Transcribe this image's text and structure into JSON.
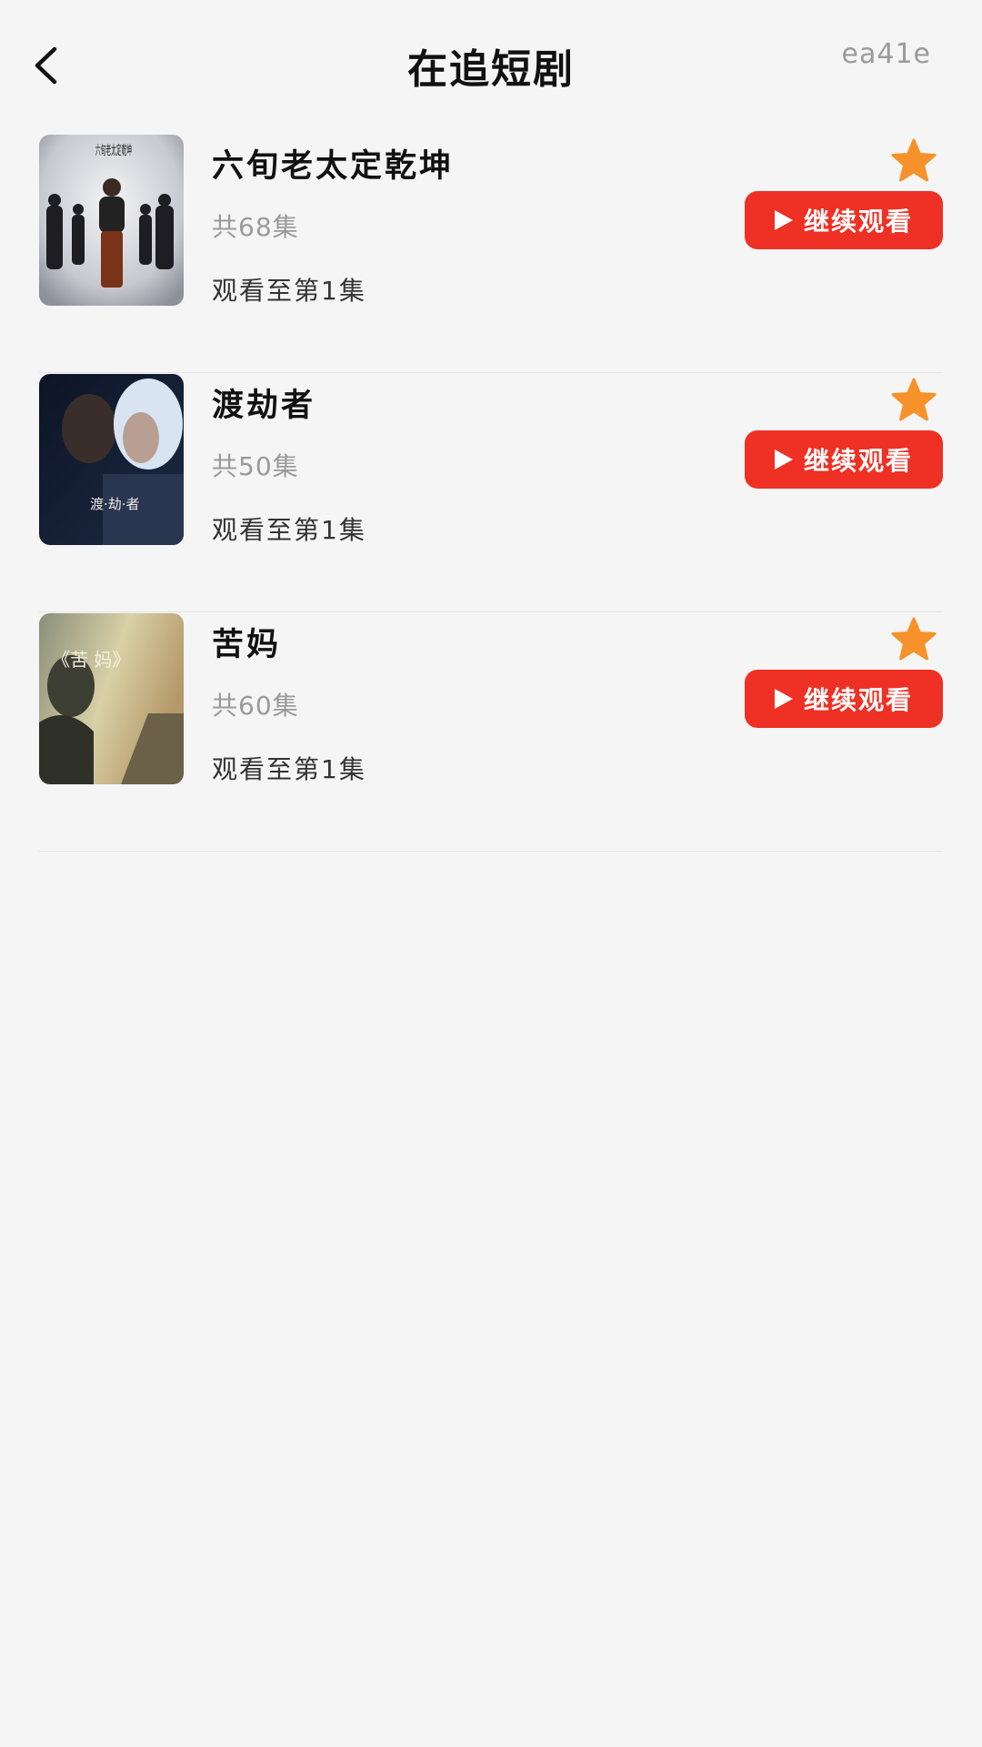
{
  "header": {
    "title": "在追短剧",
    "code": "ea41e",
    "back_icon": "chevron-left-icon"
  },
  "colors": {
    "accent": "#ee3124",
    "star": "#f7922a",
    "background": "#f5f5f5"
  },
  "dramas": [
    {
      "title": "六旬老太定乾坤",
      "episodes": "共68集",
      "progress": "观看至第1集",
      "button_label": "继续观看",
      "cover_text": "六旬老太定乾坤"
    },
    {
      "title": "渡劫者",
      "episodes": "共50集",
      "progress": "观看至第1集",
      "button_label": "继续观看",
      "cover_text": "渡·劫·者"
    },
    {
      "title": "苦妈",
      "episodes": "共60集",
      "progress": "观看至第1集",
      "button_label": "继续观看",
      "cover_text": "《苦 妈》"
    }
  ]
}
